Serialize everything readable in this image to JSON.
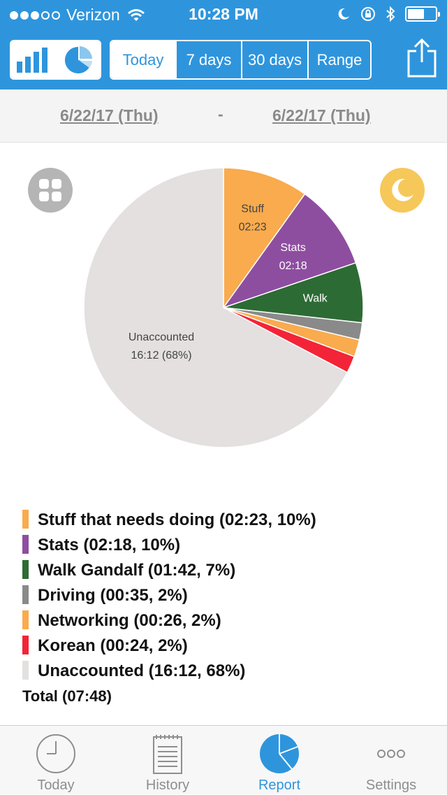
{
  "status_bar": {
    "carrier": "Verizon",
    "time": "10:28 PM",
    "signal_bars_filled": 3,
    "signal_bars_total": 5,
    "battery_level": 0.6
  },
  "toolbar": {
    "chart_views": [
      "bar-chart-icon",
      "pie-chart-icon"
    ],
    "selected_view": "pie-chart-icon",
    "ranges": [
      "Today",
      "7 days",
      "30 days",
      "Range"
    ],
    "selected_range": "Today",
    "share_icon": "share-icon"
  },
  "date_range": {
    "start": "6/22/17 (Thu)",
    "separator": "-",
    "end": "6/22/17 (Thu)"
  },
  "corner_buttons": {
    "left_icon": "grid-icon",
    "right_icon": "moon-icon"
  },
  "chart_data": {
    "type": "pie",
    "slices": [
      {
        "label": "Stuff",
        "value_label": "02:23",
        "duration": "02:23",
        "percent": 10,
        "color": "#f9ab4d"
      },
      {
        "label": "Stats",
        "value_label": "02:18",
        "duration": "02:18",
        "percent": 10,
        "color": "#8e4ea0"
      },
      {
        "label": "Walk",
        "value_label": "",
        "duration": "01:42",
        "percent": 7,
        "color": "#2d6b34"
      },
      {
        "label": "",
        "value_label": "",
        "duration": "00:35",
        "percent": 2,
        "color": "#8a8a8a"
      },
      {
        "label": "",
        "value_label": "",
        "duration": "00:26",
        "percent": 2,
        "color": "#f9ab4d"
      },
      {
        "label": "",
        "value_label": "",
        "duration": "00:24",
        "percent": 2,
        "color": "#f32437"
      },
      {
        "label": "Unaccounted",
        "value_label": "16:12 (68%)",
        "duration": "16:12",
        "percent": 68,
        "color": "#e3e0df"
      }
    ]
  },
  "legend": {
    "items": [
      {
        "text": "Stuff that needs doing (02:23, 10%)",
        "color": "#f9ab4d"
      },
      {
        "text": "Stats (02:18, 10%)",
        "color": "#8e4ea0"
      },
      {
        "text": "Walk Gandalf (01:42, 7%)",
        "color": "#2d6b34"
      },
      {
        "text": "Driving (00:35, 2%)",
        "color": "#8a8a8a"
      },
      {
        "text": "Networking (00:26, 2%)",
        "color": "#f9ab4d"
      },
      {
        "text": "Korean (00:24, 2%)",
        "color": "#f32437"
      },
      {
        "text": "Unaccounted (16:12, 68%)",
        "color": "#e3e0df"
      }
    ],
    "total": "Total (07:48)"
  },
  "tabbar": {
    "tabs": [
      {
        "label": "Today",
        "icon": "clock-icon"
      },
      {
        "label": "History",
        "icon": "notepad-icon"
      },
      {
        "label": "Report",
        "icon": "pie-chart-icon"
      },
      {
        "label": "Settings",
        "icon": "more-icon"
      }
    ],
    "active": "Report"
  },
  "colors": {
    "accent": "#2e95dd",
    "tab_inactive": "#8e8e8e"
  }
}
